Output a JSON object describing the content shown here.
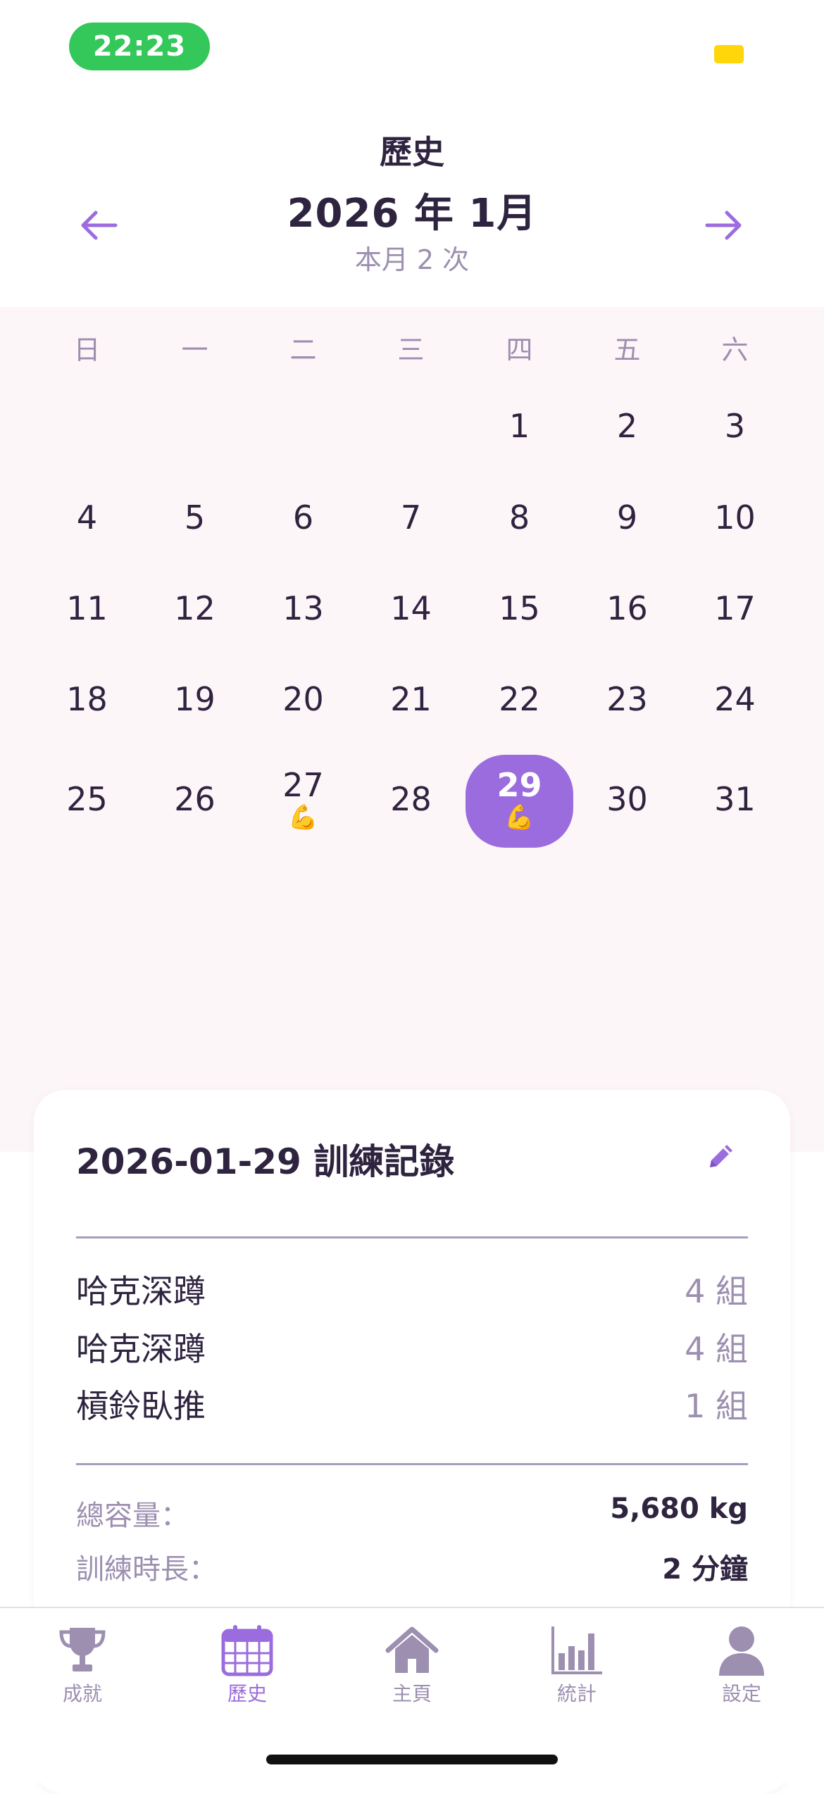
{
  "status_bar": {
    "time": "22:23"
  },
  "header": {
    "page_title": "歷史",
    "month_title": "2026 年 1月",
    "month_subtitle": "本月 2 次"
  },
  "calendar": {
    "weekdays": [
      "日",
      "一",
      "二",
      "三",
      "四",
      "五",
      "六"
    ],
    "days": [
      "1",
      "2",
      "3",
      "4",
      "5",
      "6",
      "7",
      "8",
      "9",
      "10",
      "11",
      "12",
      "13",
      "14",
      "15",
      "16",
      "17",
      "18",
      "19",
      "20",
      "21",
      "22",
      "23",
      "24",
      "25",
      "26",
      "27",
      "28",
      "29",
      "30",
      "31"
    ],
    "workout_mark": "💪",
    "selected_day": "29"
  },
  "record_card": {
    "title": "2026-01-29 訓練記錄",
    "exercises": [
      {
        "name": "哈克深蹲",
        "sets": "4 組"
      },
      {
        "name": "哈克深蹲",
        "sets": "4 組"
      },
      {
        "name": "槓鈴臥推",
        "sets": "1 組"
      }
    ],
    "summary": [
      {
        "label": "總容量：",
        "value": "5,680 kg"
      },
      {
        "label": "訓練時長：",
        "value": "2 分鐘"
      }
    ]
  },
  "tab_bar": {
    "tabs": [
      {
        "label": "成就",
        "icon": "trophy-icon"
      },
      {
        "label": "歷史",
        "icon": "calendar-icon",
        "active": true
      },
      {
        "label": "主頁",
        "icon": "home-icon"
      },
      {
        "label": "統計",
        "icon": "chart-icon"
      },
      {
        "label": "設定",
        "icon": "person-icon"
      }
    ]
  },
  "colors": {
    "accent": "#9b6cdd",
    "text_dark": "#2f2440",
    "text_muted": "#9c8fb0",
    "calendar_bg": "#fdf6f8",
    "status_green": "#34c759"
  }
}
